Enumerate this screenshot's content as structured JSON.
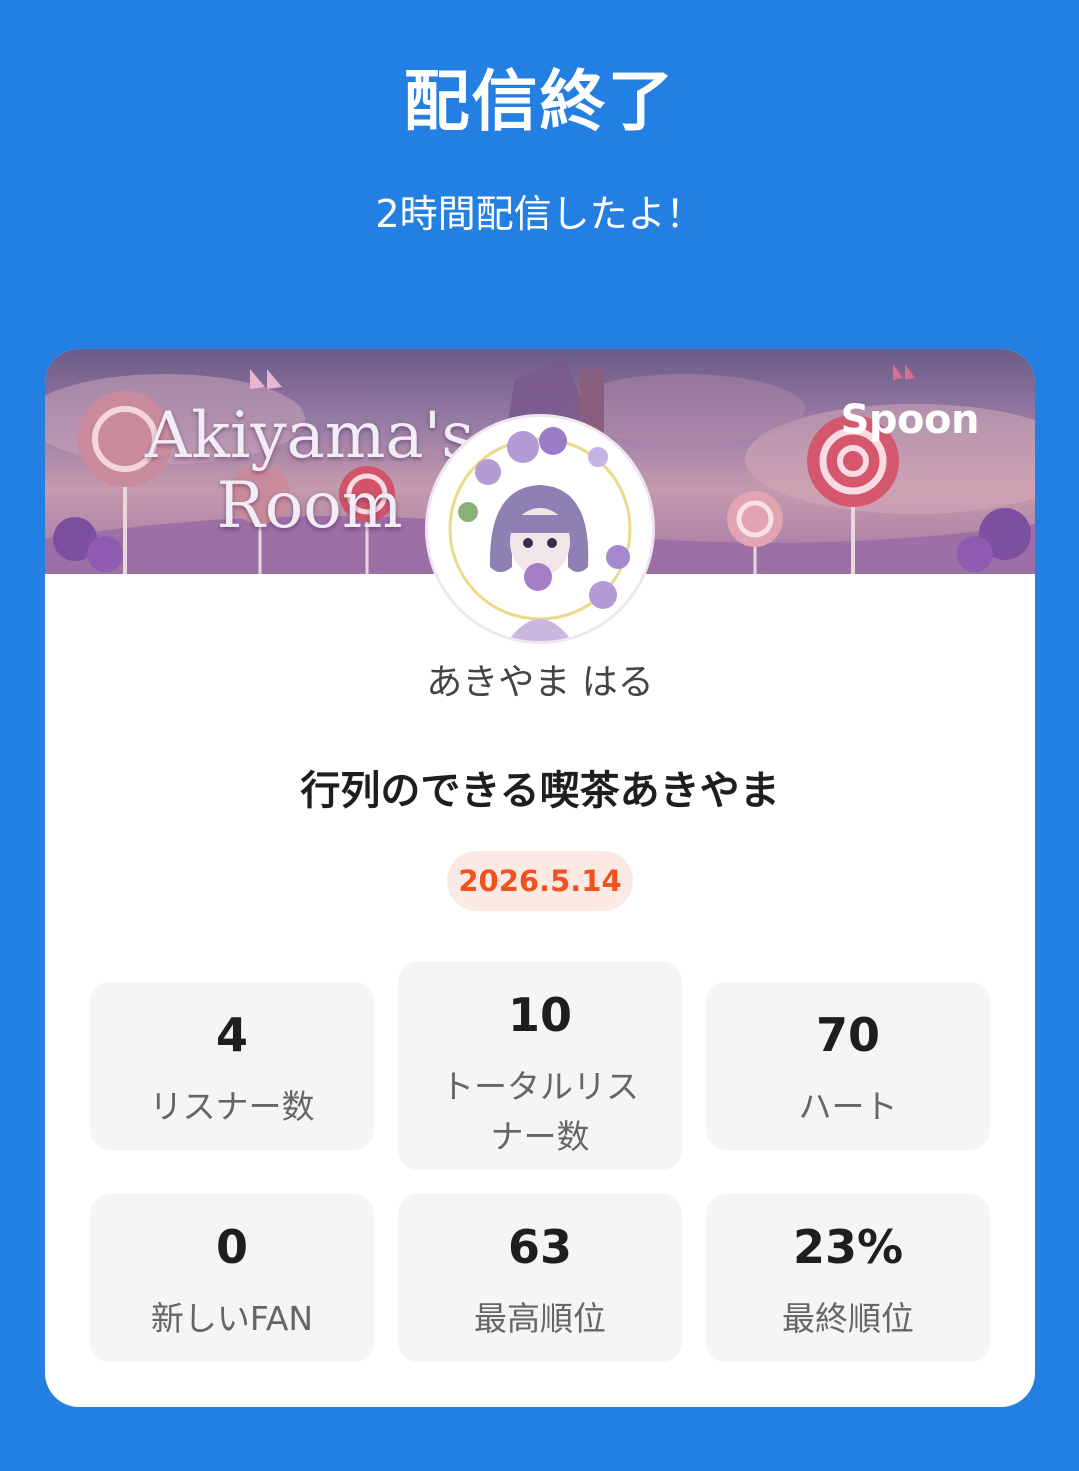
{
  "header": {
    "title": "配信終了",
    "subtitle": "2時間配信したよ！"
  },
  "banner": {
    "title_line1": "Akiyama's",
    "title_line2": "Room",
    "logo": "Spoon"
  },
  "profile": {
    "username": "あきやま はる",
    "room_title": "行列のできる喫茶あきやま",
    "date": "2026.5.14"
  },
  "stats": [
    {
      "value": "4",
      "label": "リスナー数"
    },
    {
      "value": "10",
      "label": "トータルリスナー数"
    },
    {
      "value": "70",
      "label": "ハート"
    },
    {
      "value": "0",
      "label": "新しいFAN"
    },
    {
      "value": "63",
      "label": "最高順位"
    },
    {
      "value": "23%",
      "label": "最終順位"
    }
  ],
  "colors": {
    "background": "#237fe1",
    "card": "#ffffff",
    "date_badge_bg": "#fde9e4",
    "date_badge_text": "#f0521f",
    "stat_box": "#f5f5f5"
  }
}
